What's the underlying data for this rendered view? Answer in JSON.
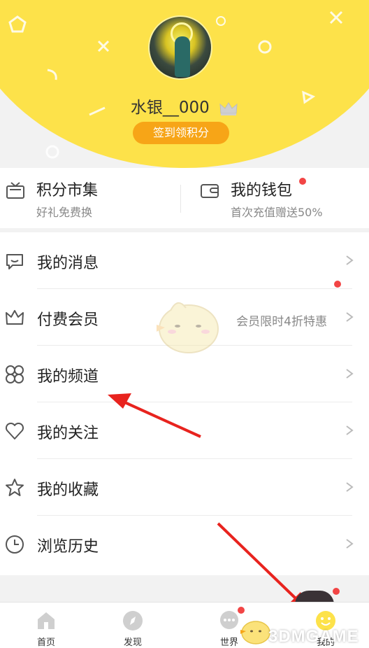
{
  "profile": {
    "username": "水银__000",
    "checkin_label": "签到领积分"
  },
  "quick": {
    "points_market": {
      "title": "积分市集",
      "subtitle": "好礼免费换"
    },
    "wallet": {
      "title": "我的钱包",
      "subtitle": "首次充值赠送50%",
      "has_dot": true
    }
  },
  "menu": {
    "items": [
      {
        "label": "我的消息",
        "icon": "message-icon"
      },
      {
        "label": "付费会员",
        "icon": "crown-icon",
        "right_text": "会员限时4折特惠",
        "has_dot": true
      },
      {
        "label": "我的频道",
        "icon": "grid-icon"
      },
      {
        "label": "我的关注",
        "icon": "heart-icon"
      },
      {
        "label": "我的收藏",
        "icon": "star-icon"
      },
      {
        "label": "浏览历史",
        "icon": "clock-icon"
      }
    ]
  },
  "tabbar": {
    "tabs": [
      {
        "label": "首页",
        "icon": "home-icon"
      },
      {
        "label": "发现",
        "icon": "compass-icon"
      },
      {
        "label": "世界",
        "icon": "chat-icon",
        "has_dot": true
      },
      {
        "label": "我的",
        "icon": "smiley-icon",
        "active": true
      }
    ]
  },
  "watermark": {
    "text": "3DMGAME"
  },
  "colors": {
    "header_yellow": "#fde24a",
    "checkin_orange": "#f7a517",
    "red_dot": "#f24545",
    "annotation_red": "#e8231e"
  }
}
